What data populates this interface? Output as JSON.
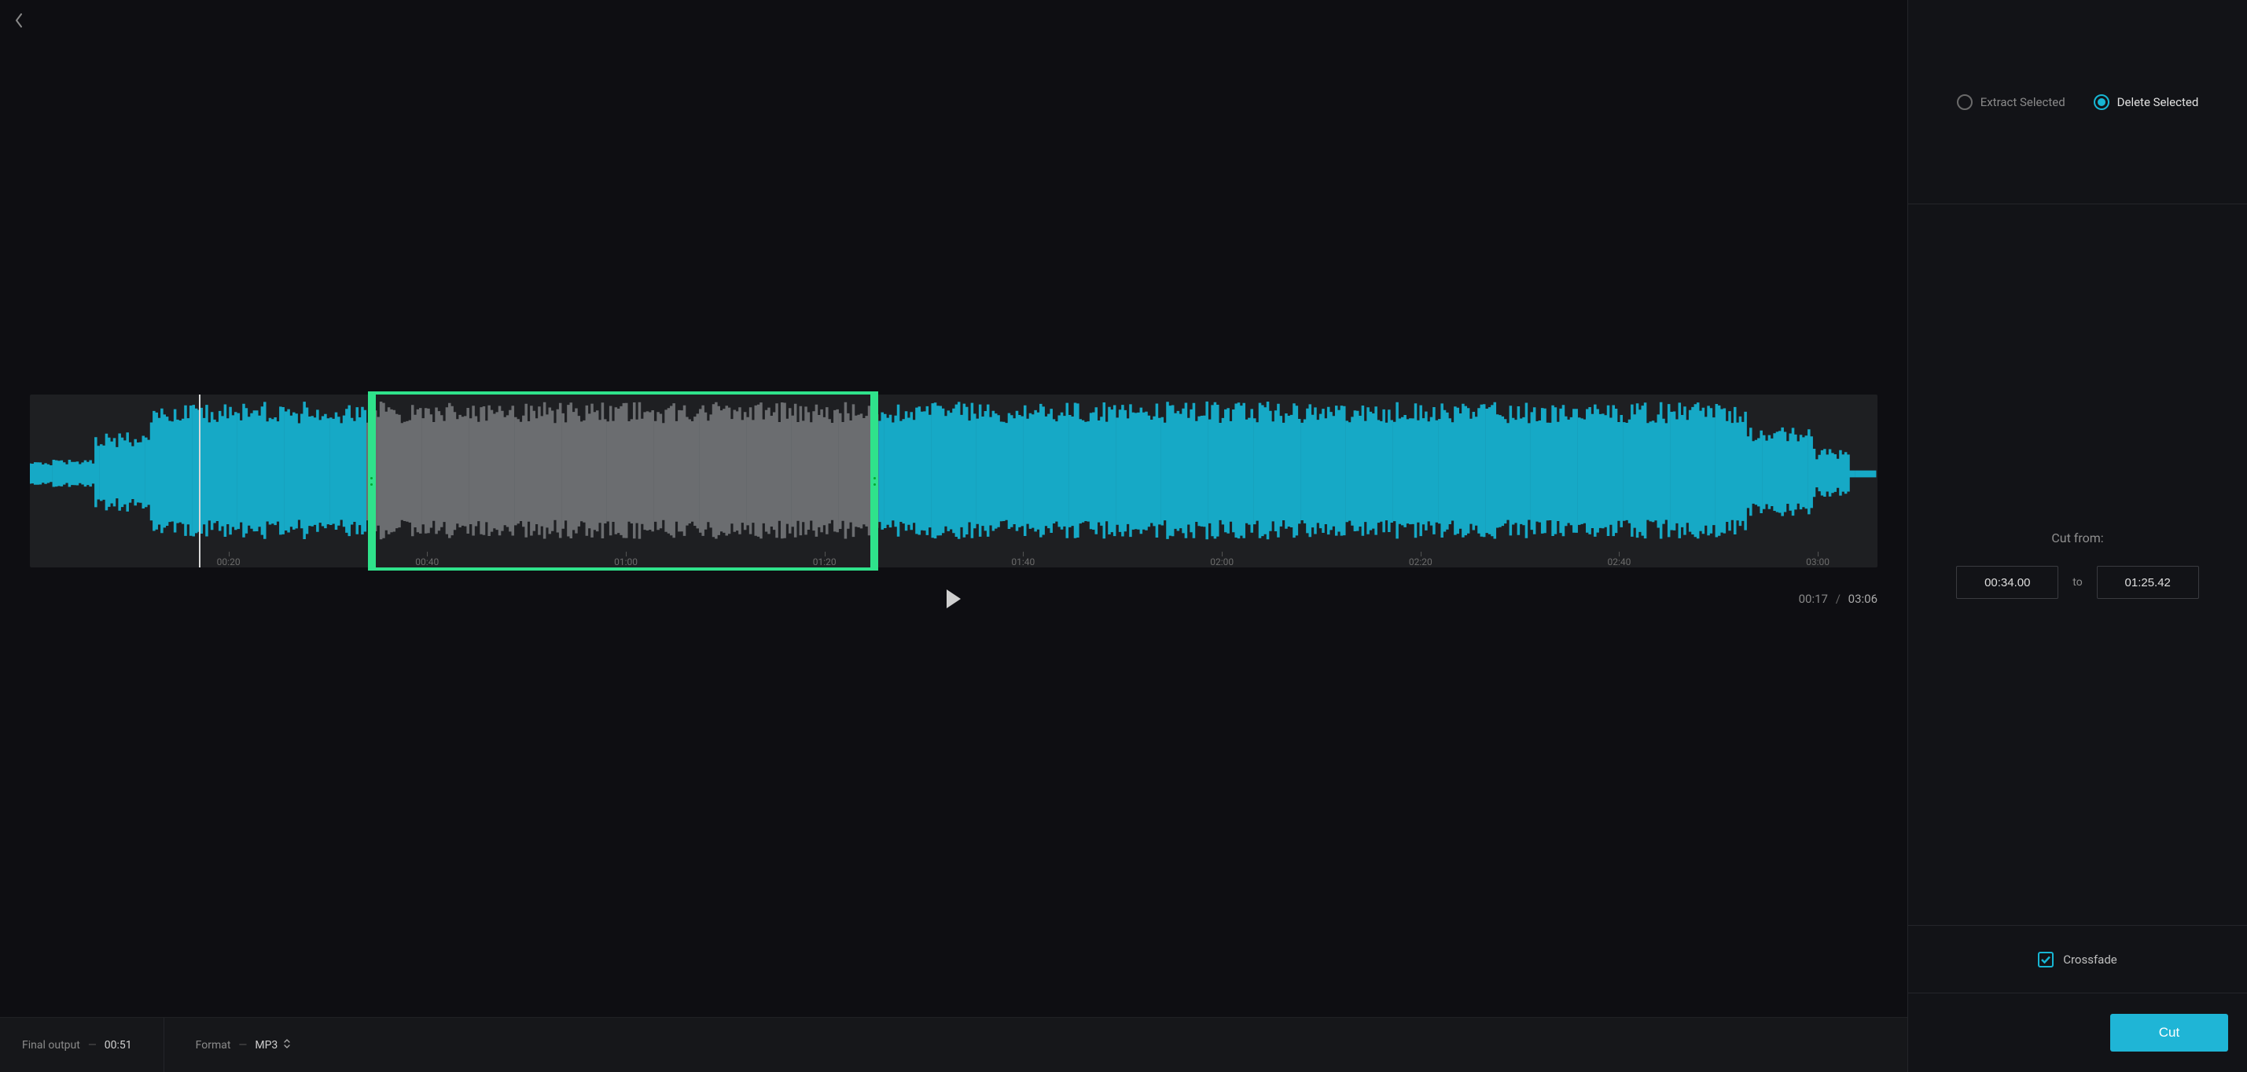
{
  "colors": {
    "waveform": "#16a9c6",
    "waveform_muted": "#6b6d70",
    "selection_border": "#2fe28b",
    "accent": "#1fb5d6"
  },
  "timeline": {
    "duration_sec": 186,
    "ticks": [
      {
        "label": "00:20",
        "pct": 10.75
      },
      {
        "label": "00:40",
        "pct": 21.5
      },
      {
        "label": "01:00",
        "pct": 32.26
      },
      {
        "label": "01:20",
        "pct": 43.01
      },
      {
        "label": "01:40",
        "pct": 53.76
      },
      {
        "label": "02:00",
        "pct": 64.52
      },
      {
        "label": "02:20",
        "pct": 75.27
      },
      {
        "label": "02:40",
        "pct": 86.02
      },
      {
        "label": "03:00",
        "pct": 96.77
      }
    ],
    "playhead_pct": 9.14,
    "selection_start_pct": 18.28,
    "selection_end_pct": 45.93
  },
  "playback": {
    "current": "00:17",
    "separator": "/",
    "total": "03:06"
  },
  "footer": {
    "final_output_label": "Final output",
    "final_output_value": "00:51",
    "format_label": "Format",
    "format_value": "MP3"
  },
  "side": {
    "mode": {
      "extract_label": "Extract Selected",
      "delete_label": "Delete Selected",
      "selected": "delete"
    },
    "cut": {
      "label": "Cut from:",
      "from": "00:34.00",
      "to_label": "to",
      "to": "01:25.42"
    },
    "crossfade": {
      "label": "Crossfade",
      "checked": true
    },
    "cut_button": "Cut"
  }
}
